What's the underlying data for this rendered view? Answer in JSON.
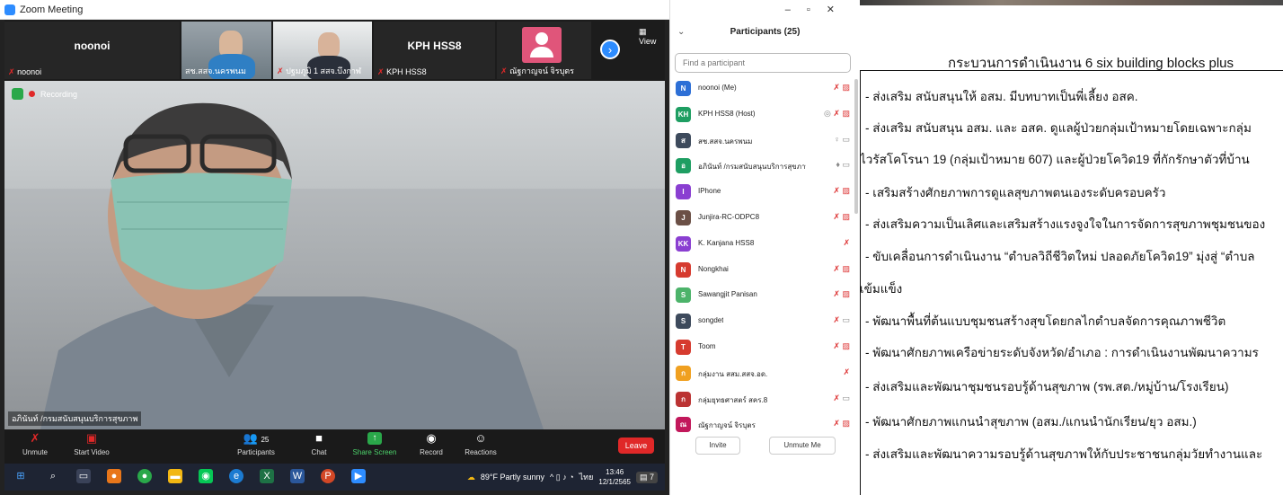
{
  "zoom": {
    "window_title": "Zoom Meeting",
    "view_label": "View",
    "gallery": [
      {
        "name": "noonoi",
        "label": "noonoi",
        "muted": true,
        "video": false
      },
      {
        "name": "",
        "label": "สช.สสจ.นครพนม",
        "muted": false,
        "video": true
      },
      {
        "name": "",
        "label": "ปฐมภูมิ 1 สสจ.บึงกาฬ",
        "muted": true,
        "video": true
      },
      {
        "name": "KPH HSS8",
        "label": "KPH HSS8",
        "muted": true,
        "video": false
      },
      {
        "name": "",
        "label": "ณัฐกาญจน์ จิรบุตร",
        "muted": true,
        "video": false
      }
    ],
    "recording_label": "Recording",
    "active_speaker_label": "อภินันท์ /กรมสนับสนุนบริการสุขภาพ",
    "toolbar": {
      "unmute": "Unmute",
      "start_video": "Start Video",
      "participants": "Participants",
      "participants_count": "25",
      "chat": "Chat",
      "share_screen": "Share Screen",
      "record": "Record",
      "reactions": "Reactions",
      "leave": "Leave"
    }
  },
  "taskbar": {
    "weather": "89°F  Partly sunny",
    "language": "ไทย",
    "time": "13:46",
    "date": "12/1/2565",
    "notification_count": "7"
  },
  "participants": {
    "title": "Participants (25)",
    "search_placeholder": "Find a participant",
    "invite": "Invite",
    "unmute_me": "Unmute Me",
    "items": [
      {
        "initials": "N",
        "color": "#2d6fd6",
        "name": "noonoi (Me)",
        "icons": "mic-muted video-off"
      },
      {
        "initials": "KH",
        "color": "#1e9e62",
        "name": "KPH HSS8 (Host)",
        "icons": "shield mic-muted video-off"
      },
      {
        "initials": "ส",
        "color": "#3d4a5c",
        "name": "สช.สสจ.นครพนม",
        "icons": "mic video"
      },
      {
        "initials": "อ",
        "color": "#1e9e62",
        "name": "อภินันท์ /กรมสนับสนุนบริการสุขภาพ",
        "icons": "mic-active video"
      },
      {
        "initials": "I",
        "color": "#8a3fd1",
        "name": "IPhone",
        "icons": "mic-muted video-off"
      },
      {
        "initials": "J",
        "color": "#6b5046",
        "name": "Junjira-RC-ODPC8",
        "icons": "mic-muted video-off"
      },
      {
        "initials": "KK",
        "color": "#8a3fd1",
        "name": "K. Kanjana HSS8",
        "icons": "mic-muted"
      },
      {
        "initials": "N",
        "color": "#d63b2f",
        "name": "Nongkhai",
        "icons": "mic-muted video-off"
      },
      {
        "initials": "S",
        "color": "#4cb36a",
        "name": "Sawangjit Panisan",
        "icons": "mic-muted video-off"
      },
      {
        "initials": "S",
        "color": "#3d4a5c",
        "name": "songdet",
        "icons": "mic-muted video"
      },
      {
        "initials": "T",
        "color": "#d63b2f",
        "name": "Toom",
        "icons": "mic-muted video-off"
      },
      {
        "initials": "ก",
        "color": "#f0a020",
        "name": "กลุ่มงาน สสม.สสจ.อด.",
        "icons": "mic-muted"
      },
      {
        "initials": "ก",
        "color": "#b33",
        "name": "กลุ่มยุทธศาสตร์ สคร.8",
        "icons": "mic-muted video"
      },
      {
        "initials": "ณ",
        "color": "#c2185b",
        "name": "ณัฐกาญจน์ จิรบุตร",
        "icons": "mic-muted video-off"
      }
    ]
  },
  "slide": {
    "title": "กระบวนการดำเนินงาน 6 six building blocks plus",
    "lines": [
      "- ส่งเสริม สนับสนุนให้ อสม. มีบทบาทเป็นพี่เลี้ยง อสค.",
      "- ส่งเสริม สนับสนุน อสม. และ อสค. ดูแลผู้ป่วยกลุ่มเป้าหมายโดยเฉพาะกลุ่ม",
      "ไวรัสโคโรนา 19 (กลุ่มเป้าหมาย 607) และผู้ป่วยโควิด19 ที่กักรักษาตัวที่บ้าน",
      "- เสริมสร้างศักยภาพการดูแลสุขภาพตนเองระดับครอบครัว",
      "- ส่งเสริมความเป็นเลิศและเสริมสร้างแรงจูงใจในการจัดการสุขภาพชุมชนของ",
      "- ขับเคลื่อนการดำเนินงาน “ตำบลวิถีชีวิตใหม่ ปลอดภัยโควิด19” มุ่งสู่ “ตำบล",
      "เข้มแข็ง",
      "- พัฒนาพื้นที่ต้นแบบชุมชนสร้างสุขโดยกลไกตำบลจัดการคุณภาพชีวิต",
      "- พัฒนาศักยภาพเครือข่ายระดับจังหวัด/อำเภอ : การดำเนินงานพัฒนาความร",
      "- ส่งเสริมและพัฒนาชุมชนรอบรู้ด้านสุขภาพ (รพ.สต./หมู่บ้าน/โรงเรียน)",
      "- พัฒนาศักยภาพแกนนำสุขภาพ (อสม./แกนนำนักเรียน/ยุว อสม.)",
      "- ส่งเสริมและพัฒนาความรอบรู้ด้านสุขภาพให้กับประชาชนกลุ่มวัยทำงานและ"
    ]
  }
}
